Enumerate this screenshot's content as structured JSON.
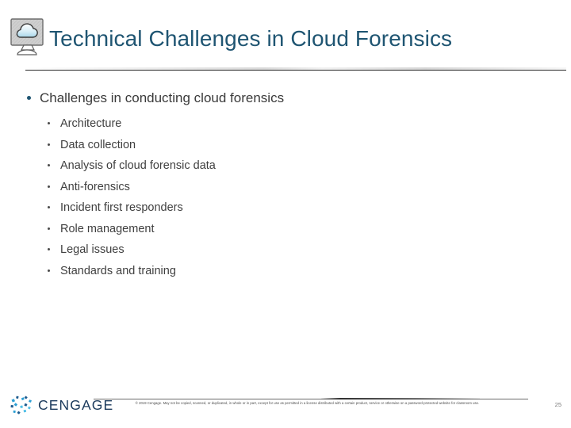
{
  "slide": {
    "title": "Technical Challenges in Cloud Forensics",
    "title_icon": "cloud-monitor-icon",
    "accent_color": "#1f5572",
    "body_text_color": "#3a3a3a"
  },
  "content": {
    "main_bullet": "Challenges in conducting cloud forensics",
    "sub_bullets": [
      "Architecture",
      "Data collection",
      "Analysis of cloud forensic data",
      "Anti-forensics",
      "Incident first responders",
      "Role management",
      "Legal issues",
      "Standards and training"
    ]
  },
  "footer": {
    "logo_text": "CENGAGE",
    "logo_mark": "cengage-dots-icon",
    "logo_color": "#1b3a5c",
    "copyright": "© 2019 Cengage. May not be copied, scanned, or duplicated, in whole or in part, except for use as permitted in a license distributed with a certain product, service or otherwise on a password-protected website for classroom use.",
    "page_number": "25"
  }
}
